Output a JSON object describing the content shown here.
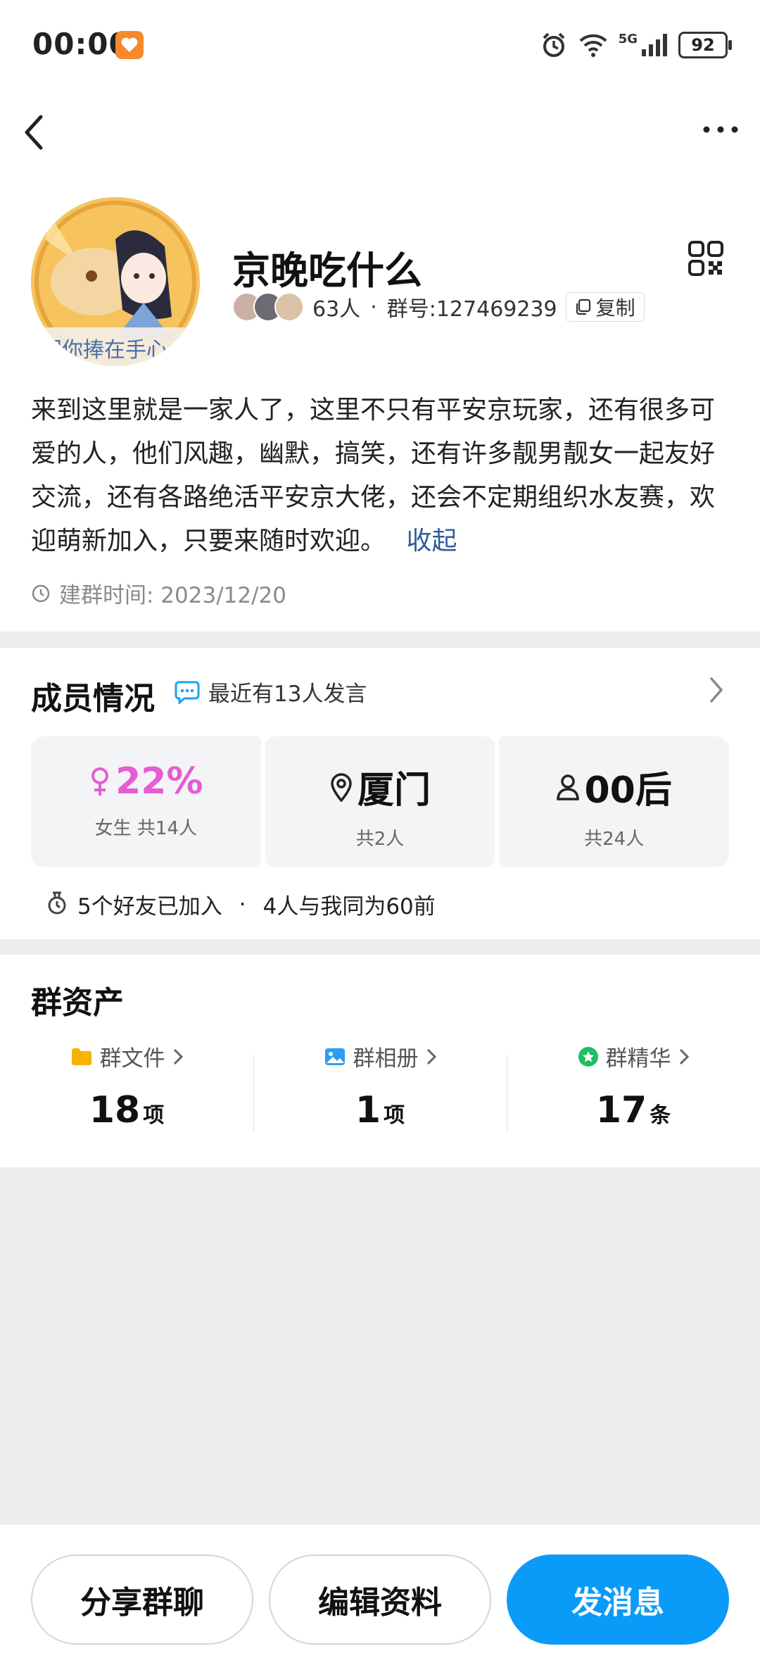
{
  "status_bar": {
    "time": "00:00",
    "network": "5G",
    "battery": "92"
  },
  "group": {
    "name": "京晚吃什么",
    "member_count": "63人",
    "separator": "·",
    "group_number": "群号:127469239",
    "copy_label": "复制",
    "avatar_caption": "把你捧在手心",
    "description": "来到这里就是一家人了，这里不只有平安京玩家，还有很多可爱的人，他们风趣，幽默，搞笑，还有许多靓男靓女一起友好交流，还有各路绝活平安京大佬，还会不定期组织水友赛，欢迎萌新加入，只要来随时欢迎。",
    "collapse_label": "收起",
    "created_time": "建群时间: 2023/12/20"
  },
  "members": {
    "title": "成员情况",
    "recent": "最近有13人发言",
    "stats": [
      {
        "value": "22%",
        "label": "女生 共14人",
        "icon": "female-icon"
      },
      {
        "value": "厦门",
        "label": "共2人",
        "icon": "location-pin-icon"
      },
      {
        "value": "00后",
        "label": "共24人",
        "icon": "person-icon"
      }
    ],
    "friends_joined": "5个好友已加入",
    "dot": "·",
    "same_age": "4人与我同为60前"
  },
  "assets": {
    "title": "群资产",
    "items": [
      {
        "label": "群文件",
        "count": "18",
        "unit": "项",
        "icon": "folder-icon",
        "color": "#F5B400"
      },
      {
        "label": "群相册",
        "count": "1",
        "unit": "项",
        "icon": "image-icon",
        "color": "#2E9CF0"
      },
      {
        "label": "群精华",
        "count": "17",
        "unit": "条",
        "icon": "star-badge-icon",
        "color": "#1DBF63"
      }
    ]
  },
  "actions": {
    "share": "分享群聊",
    "edit": "编辑资料",
    "message": "发消息"
  },
  "colors": {
    "accent": "#0A9BF9",
    "female": "#E45DD3",
    "link": "#2E5B9B"
  }
}
